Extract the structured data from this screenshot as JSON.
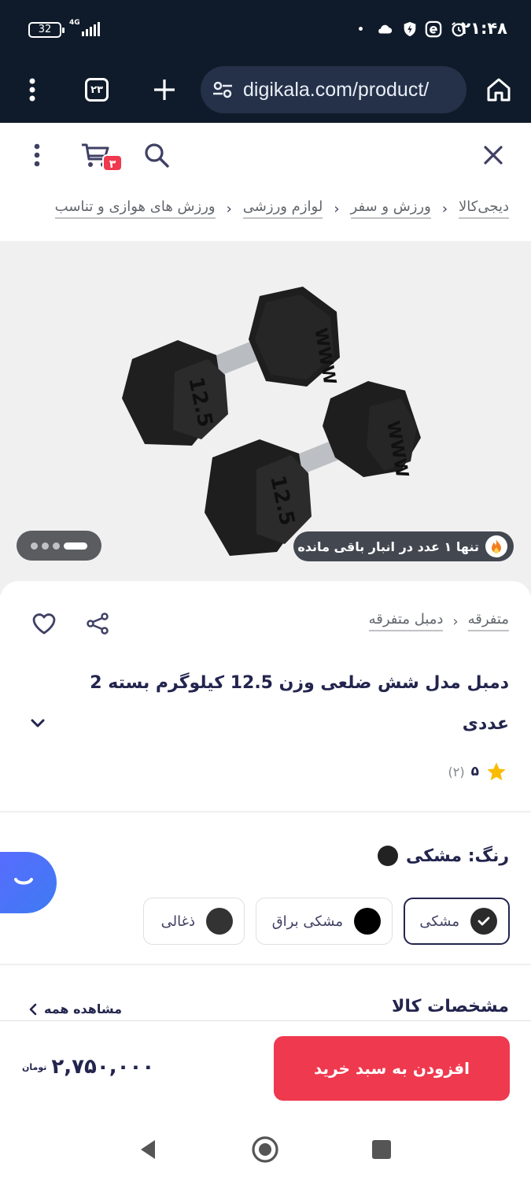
{
  "status_bar": {
    "battery": "32",
    "network": "4G",
    "time": "۲۱:۴۸"
  },
  "browser": {
    "tabs_count": "۲۳",
    "url": "digikala.com/product/"
  },
  "header": {
    "cart_count": "۳"
  },
  "breadcrumb": [
    "دیجی‌کالا",
    "ورزش و سفر",
    "لوازم ورزشی",
    "ورزش های هوازی و تناسب"
  ],
  "gallery": {
    "stock_notice": "تنها ۱ عدد در انبار باقی مانده",
    "plate_label": "12.5"
  },
  "product": {
    "category_crumb": [
      "متفرقه",
      "دمبل متفرقه"
    ],
    "title": "دمبل مدل شش ضلعی وزن 12.5 کیلوگرم بسته 2 عددی",
    "rating_score": "۵",
    "rating_count": "(۲)"
  },
  "color": {
    "label": "رنگ: مشکی",
    "options": [
      {
        "name": "مشکی",
        "swatch": "#2b2b2b",
        "selected": true
      },
      {
        "name": "مشکی براق",
        "swatch": "#000000",
        "selected": false
      },
      {
        "name": "ذغالی",
        "swatch": "#333333",
        "selected": false
      }
    ]
  },
  "specs": {
    "title": "مشخصات کالا",
    "see_all": "مشاهده همه"
  },
  "buy": {
    "button_label": "افزودن به سبد خرید",
    "price": "۲,۷۵۰,۰۰۰",
    "currency": "تومان"
  },
  "colors": {
    "accent": "#ef394e",
    "dark_bar": "#0f1b2a",
    "text": "#23254e"
  }
}
